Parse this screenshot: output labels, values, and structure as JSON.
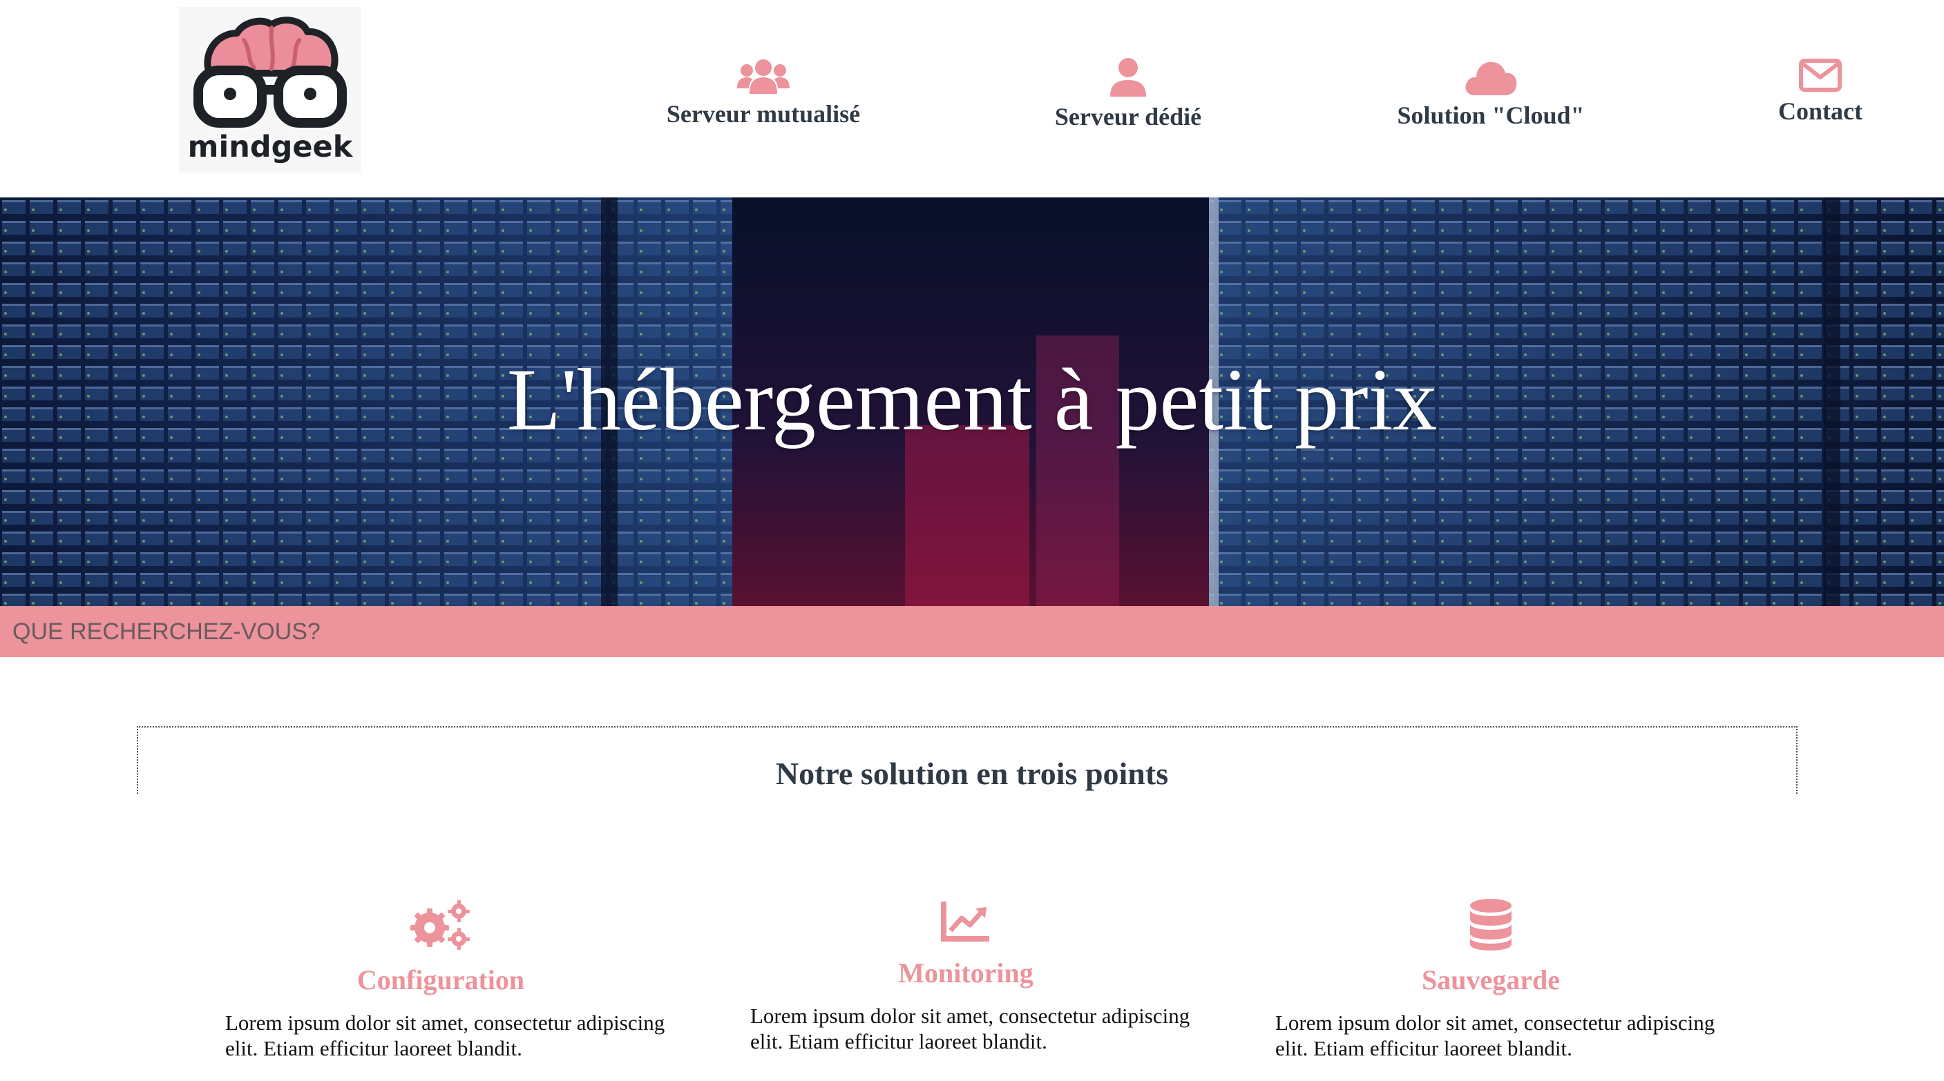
{
  "brand": {
    "logo_text": "mindgeek",
    "logo_icon": "brain-glasses-icon"
  },
  "nav": [
    {
      "label": "Serveur mutualisé",
      "icon": "users-icon"
    },
    {
      "label": "Serveur dédié",
      "icon": "user-icon"
    },
    {
      "label": "Solution \"Cloud\"",
      "icon": "cloud-icon"
    },
    {
      "label": "Contact",
      "icon": "envelope-icon"
    }
  ],
  "hero": {
    "title": "L'hébergement à petit prix"
  },
  "search": {
    "placeholder": "QUE RECHERCHEZ-VOUS?",
    "value": ""
  },
  "section": {
    "title": "Notre solution en trois points",
    "features": [
      {
        "icon": "cogs-icon",
        "title": "Configuration",
        "text": "Lorem ipsum dolor sit amet, consectetur adipiscing elit. Etiam efficitur laoreet blandit."
      },
      {
        "icon": "chart-line-icon",
        "title": "Monitoring",
        "text": "Lorem ipsum dolor sit amet, consectetur adipiscing elit. Etiam efficitur laoreet blandit."
      },
      {
        "icon": "database-icon",
        "title": "Sauvegarde",
        "text": "Lorem ipsum dolor sit amet, consectetur adipiscing elit. Etiam efficitur laoreet blandit."
      }
    ]
  },
  "colors": {
    "accent": "#ec939c",
    "text": "#2f3a45",
    "hero_bg": "#0a1430"
  }
}
